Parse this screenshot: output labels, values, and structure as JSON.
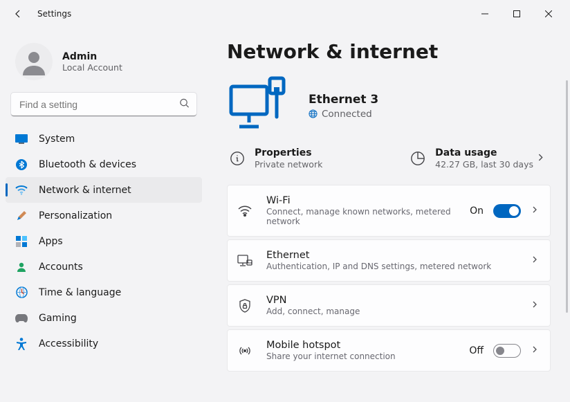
{
  "window": {
    "title": "Settings"
  },
  "user": {
    "name": "Admin",
    "account_type": "Local Account"
  },
  "search": {
    "placeholder": "Find a setting"
  },
  "nav": {
    "items": [
      {
        "label": "System"
      },
      {
        "label": "Bluetooth & devices"
      },
      {
        "label": "Network & internet"
      },
      {
        "label": "Personalization"
      },
      {
        "label": "Apps"
      },
      {
        "label": "Accounts"
      },
      {
        "label": "Time & language"
      },
      {
        "label": "Gaming"
      },
      {
        "label": "Accessibility"
      }
    ],
    "active_index": 2
  },
  "page": {
    "title": "Network & internet",
    "connection": {
      "name": "Ethernet 3",
      "status": "Connected"
    },
    "properties": {
      "title": "Properties",
      "sub": "Private network"
    },
    "datausage": {
      "title": "Data usage",
      "sub": "42.27 GB, last 30 days"
    }
  },
  "cards": {
    "wifi": {
      "title": "Wi-Fi",
      "sub": "Connect, manage known networks, metered network",
      "state_label": "On",
      "state_on": true
    },
    "ethernet": {
      "title": "Ethernet",
      "sub": "Authentication, IP and DNS settings, metered network"
    },
    "vpn": {
      "title": "VPN",
      "sub": "Add, connect, manage"
    },
    "hotspot": {
      "title": "Mobile hotspot",
      "sub": "Share your internet connection",
      "state_label": "Off",
      "state_on": false
    }
  }
}
